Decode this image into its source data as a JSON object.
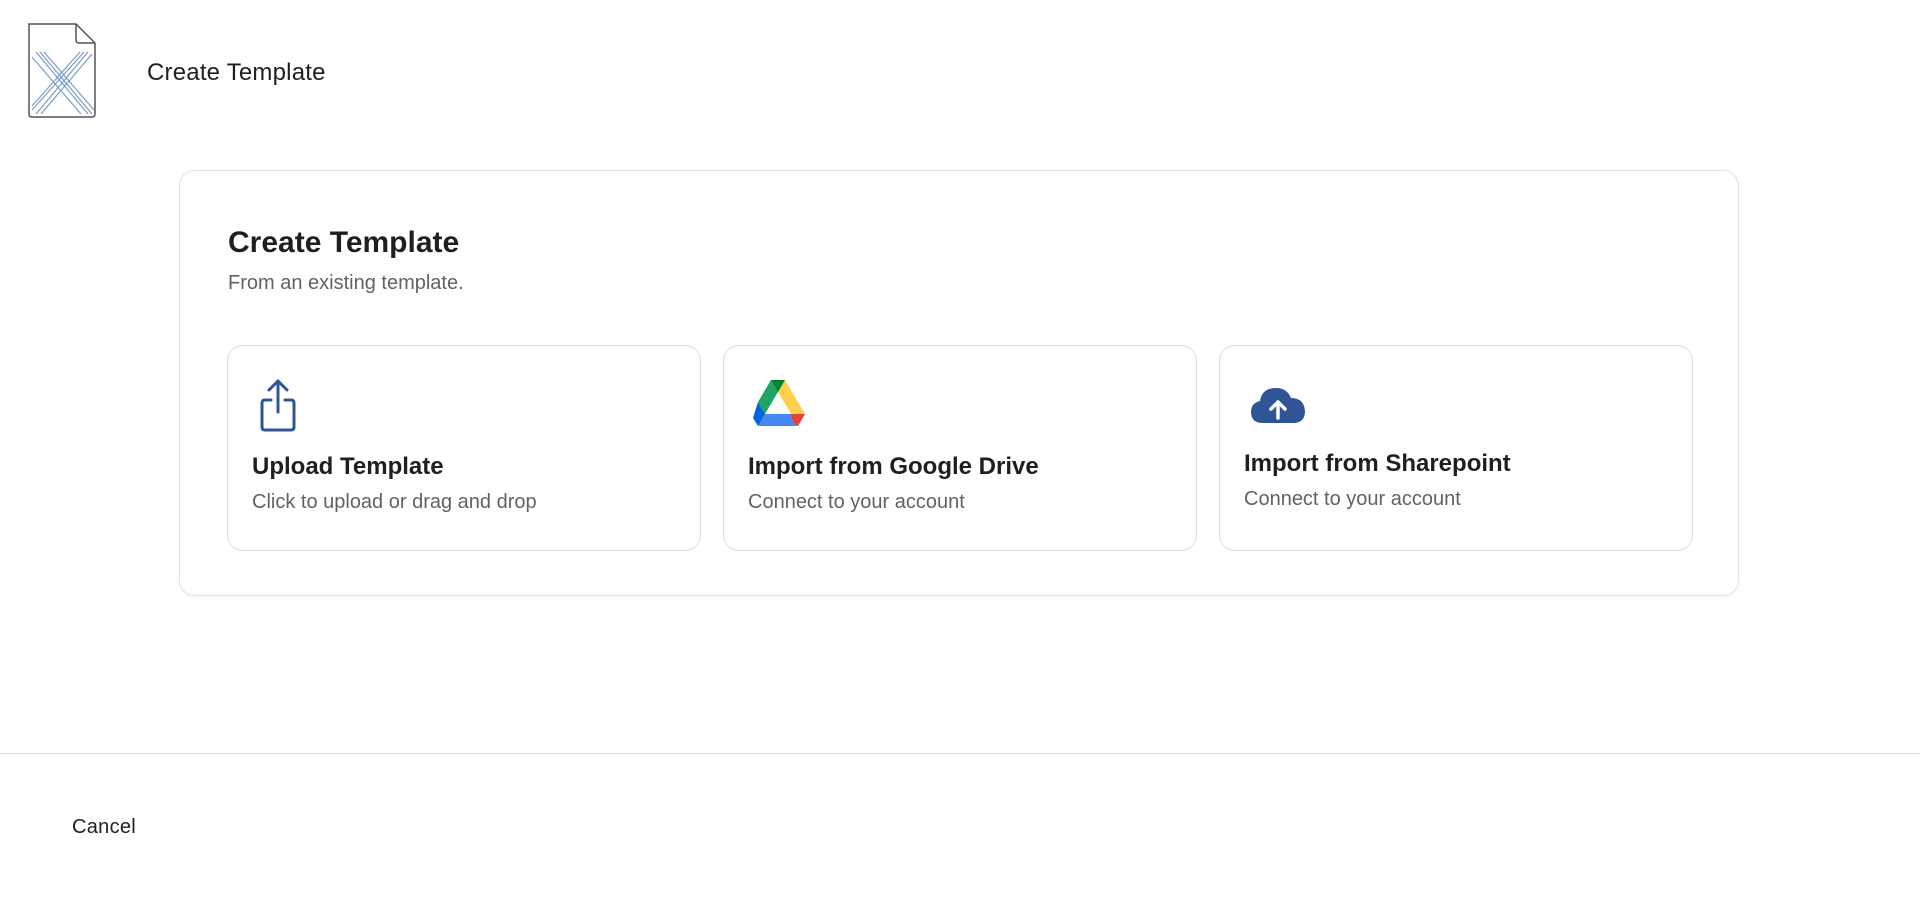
{
  "header": {
    "logo_icon": "document-x-logo",
    "title": "Create Template"
  },
  "panel": {
    "title": "Create Template",
    "subtitle": "From an existing template."
  },
  "options": [
    {
      "icon": "share-upload-icon",
      "title": "Upload Template",
      "description": "Click to upload or drag and drop",
      "icon_color": "#2f5597"
    },
    {
      "icon": "google-drive-icon",
      "title": "Import from Google Drive",
      "description": "Connect to your account",
      "icon_colors": [
        "#1fa463",
        "#ffd04b",
        "#4688f4"
      ]
    },
    {
      "icon": "cloud-upload-icon",
      "title": "Import from Sharepoint",
      "description": "Connect to your account",
      "icon_color": "#2f5597"
    }
  ],
  "footer": {
    "cancel_label": "Cancel"
  }
}
